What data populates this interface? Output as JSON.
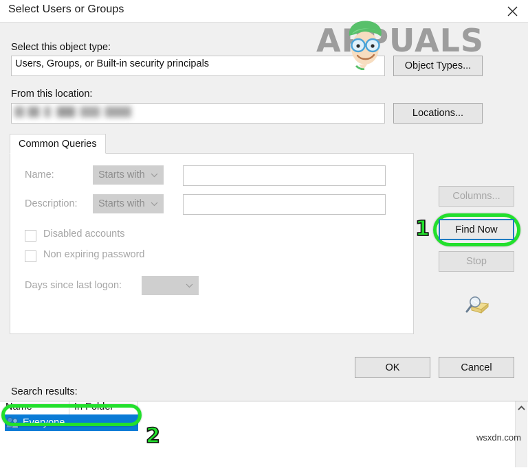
{
  "window": {
    "title": "Select Users or Groups",
    "close_icon": "close-icon"
  },
  "object_type": {
    "label": "Select this object type:",
    "value": "Users, Groups, or Built-in security principals",
    "button_label": "Object Types..."
  },
  "location": {
    "label": "From this location:",
    "value": "",
    "button_label": "Locations..."
  },
  "tabs": [
    {
      "label": "Common Queries",
      "selected": true
    }
  ],
  "common_queries": {
    "name": {
      "label": "Name:",
      "operator": "Starts with",
      "value": ""
    },
    "description": {
      "label": "Description:",
      "operator": "Starts with",
      "value": ""
    },
    "disabled_accounts": {
      "label": "Disabled accounts",
      "checked": false
    },
    "non_expiring_password": {
      "label": "Non expiring password",
      "checked": false
    },
    "days_since_last_logon": {
      "label": "Days since last logon:",
      "value": ""
    }
  },
  "right_buttons": {
    "columns": "Columns...",
    "find_now": "Find Now",
    "stop": "Stop",
    "search_icon": "magnifier-folder-icon"
  },
  "footer_buttons": {
    "ok": "OK",
    "cancel": "Cancel"
  },
  "search_results": {
    "label": "Search results:",
    "columns": [
      "Name",
      "In Folder"
    ],
    "rows": [
      {
        "name": "Everyone",
        "in_folder": "",
        "selected": true,
        "icon": "users-group-icon"
      }
    ],
    "scroll_up_icon": "chevron-up-icon"
  },
  "annotations": [
    {
      "number": "1",
      "target": "find-now-button",
      "color": "#22e02c"
    },
    {
      "number": "2",
      "target": "result-row-everyone",
      "color": "#22e02c"
    }
  ],
  "watermarks": {
    "brand": "APPUALS",
    "site": "wsxdn.com"
  }
}
